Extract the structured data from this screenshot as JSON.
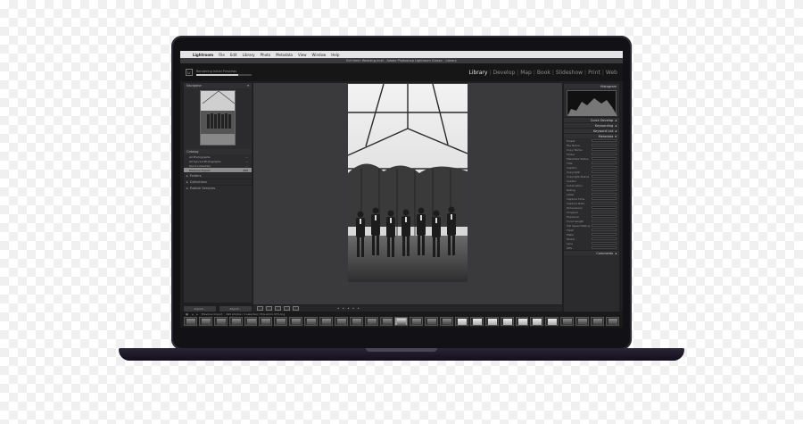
{
  "menubar": {
    "app": "Lightroom",
    "items": [
      "File",
      "Edit",
      "Library",
      "Photo",
      "Metadata",
      "View",
      "Window",
      "Help"
    ]
  },
  "window_title": "Ed+Amin Wedding.lrcat - Adobe Photoshop Lightroom Classic - Library",
  "identity": {
    "progress_label": "Rendering Initial Previews",
    "progress_value": 0.75,
    "modules": [
      "Library",
      "Develop",
      "Map",
      "Book",
      "Slideshow",
      "Print",
      "Web"
    ],
    "active_module": "Library"
  },
  "left_panel": {
    "navigator": "Navigator",
    "catalog_header": "Catalog",
    "catalog_items": [
      {
        "label": "All Photographs",
        "count": "..."
      },
      {
        "label": "All Synced Photographs",
        "count": "..."
      },
      {
        "label": "Quick Collection",
        "count": "..."
      },
      {
        "label": "Previous Import",
        "count": "495"
      }
    ],
    "sections": [
      "Folders",
      "Collections",
      "Publish Services"
    ],
    "import_button": "Import...",
    "export_button": "Export..."
  },
  "right_panel": {
    "histogram": "Histogram",
    "quick_develop": "Quick Develop",
    "keywording": "Keywording",
    "keyword_list": "Keyword List",
    "metadata": "Metadata",
    "comments": "Comments",
    "metadata_rows": [
      "Preset",
      "File Name",
      "Copy Name",
      "Folder",
      "Metadata Status",
      "Title",
      "Caption",
      "Copyright",
      "Copyright Status",
      "Creator",
      "Sublocation",
      "Rating",
      "Label",
      "Capture Time",
      "Capture Date",
      "Dimensions",
      "Cropped",
      "Exposure",
      "Focal Length",
      "ISO Speed Rating",
      "Flash",
      "Make",
      "Model",
      "Lens",
      "GPS"
    ]
  },
  "filmstrip": {
    "path_label": "Previous Import",
    "info": "495 photos / 1 selected / Ed+Amin-373.dng"
  },
  "colors": {
    "accent": "#e5e5e5",
    "panel": "#2b2b2d"
  }
}
